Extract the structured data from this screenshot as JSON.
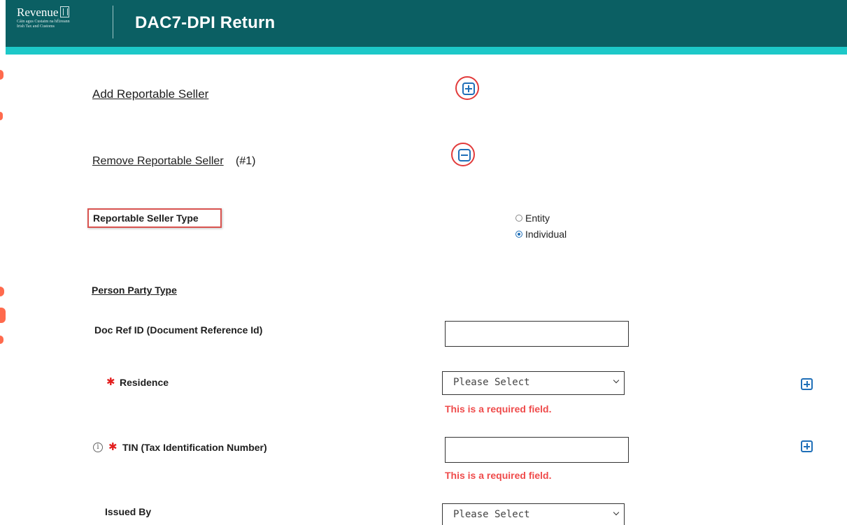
{
  "header": {
    "logo_name": "Revenue",
    "logo_sub_line1": "Cáin agus Custaim na hÉireann",
    "logo_sub_line2": "Irish Tax and Customs",
    "title": "DAC7-DPI Return"
  },
  "seller": {
    "add_label": "Add Reportable Seller",
    "remove_label": "Remove Reportable Seller",
    "remove_index": "(#1)",
    "type_label": "Reportable Seller Type",
    "type_options": [
      "Entity",
      "Individual"
    ],
    "type_selected": "Individual"
  },
  "person": {
    "party_type_label": "Person Party Type",
    "doc_ref_label": "Doc Ref ID (Document Reference Id)",
    "doc_ref_value": "",
    "residence_label": "Residence",
    "residence_selected": "Please Select",
    "residence_error": "This is a required field.",
    "tin_label": "TIN (Tax Identification Number)",
    "tin_value": "",
    "tin_error": "This is a required field.",
    "issued_by_label": "Issued By",
    "issued_by_selected": "Please Select"
  },
  "colors": {
    "header_bg": "#0b5f63",
    "header_stripe": "#1dc8c8",
    "error": "#ef4b4b",
    "required_star": "#e31e1e",
    "icon_blue": "#1f6fb8",
    "annotation_red": "#d9534f"
  }
}
